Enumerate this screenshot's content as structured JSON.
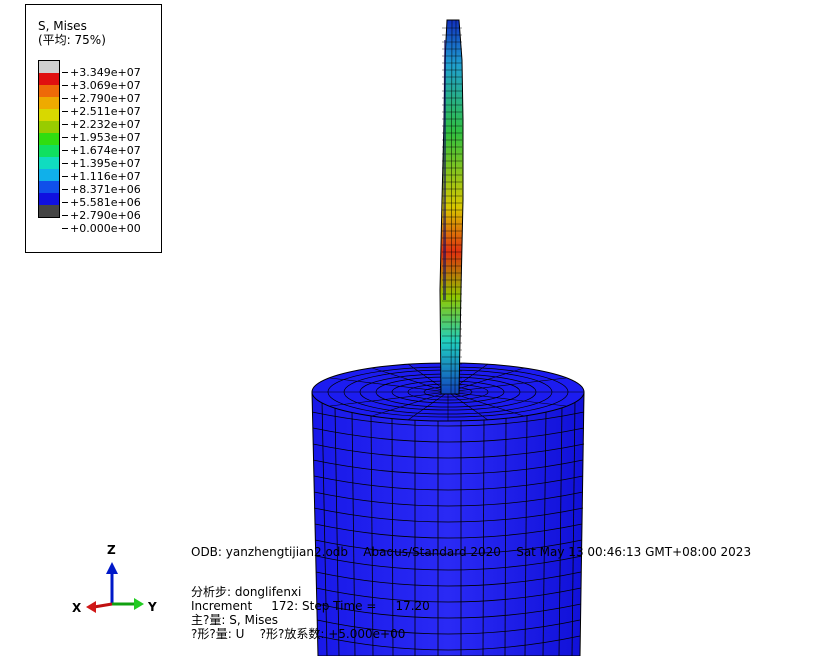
{
  "legend": {
    "title_line1": "S, Mises",
    "title_line2": "(平均: 75%)",
    "entries": [
      {
        "value": "+3.349e+07",
        "color": "#d0d0d0"
      },
      {
        "value": "+3.069e+07",
        "color": "#e01010"
      },
      {
        "value": "+2.790e+07",
        "color": "#ee6a08"
      },
      {
        "value": "+2.511e+07",
        "color": "#eeaa00"
      },
      {
        "value": "+2.232e+07",
        "color": "#d8d800"
      },
      {
        "value": "+1.953e+07",
        "color": "#98cc00"
      },
      {
        "value": "+1.674e+07",
        "color": "#30dd10"
      },
      {
        "value": "+1.395e+07",
        "color": "#10e060"
      },
      {
        "value": "+1.116e+07",
        "color": "#10dcc0"
      },
      {
        "value": "+8.371e+06",
        "color": "#10b0ea"
      },
      {
        "value": "+5.581e+06",
        "color": "#1050ea"
      },
      {
        "value": "+2.790e+06",
        "color": "#1010e0"
      },
      {
        "value": "+0.000e+00",
        "color": "#454545"
      }
    ]
  },
  "info": {
    "odb_line": "ODB: yanzhengtijian2.odb    Abaqus/Standard 2020    Sat May 13 00:46:13 GMT+08:00 2023",
    "step_line": "分析步: donglifenxi",
    "increment_line": "Increment     172: Step Time =     17.20",
    "primary_line": "主?量: S, Mises",
    "deformed_line": "?形?量: U    ?形?放系数: +5.000e+00"
  },
  "triad": {
    "x_label": "X",
    "y_label": "Y",
    "z_label": "Z"
  }
}
